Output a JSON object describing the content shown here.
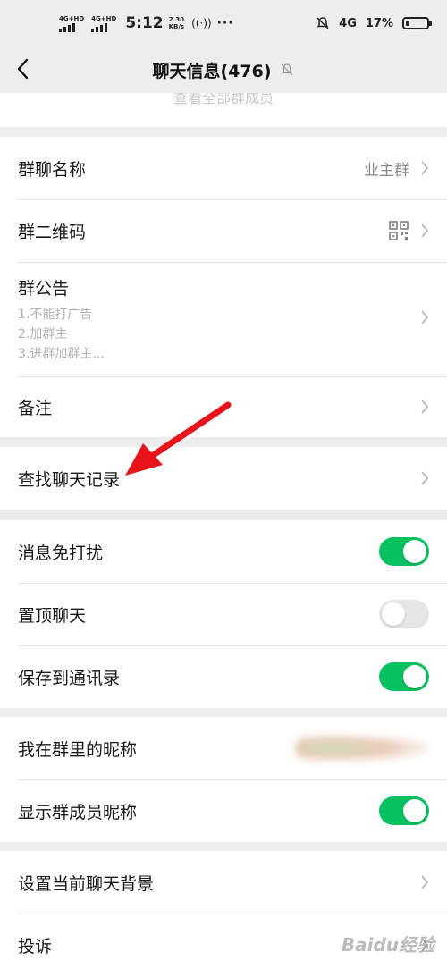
{
  "statusbar": {
    "sim1": "4G+HD",
    "sim2": "4G+HD",
    "time": "5:12",
    "speed_value": "2.30",
    "speed_unit": "KB/s",
    "more": "···",
    "network": "4G",
    "battery": "17%",
    "battery_level": 0.17
  },
  "navbar": {
    "title": "聊天信息(476)"
  },
  "partial_text": "查看全部群成员",
  "section1": {
    "group_name_label": "群聊名称",
    "group_name_value": "业主群",
    "qr_label": "群二维码",
    "notice_label": "群公告",
    "notice_lines": [
      "1.不能打广告",
      "2.加群主",
      "3.进群加群主..."
    ],
    "remark_label": "备注"
  },
  "section2": {
    "search_label": "查找聊天记录"
  },
  "section3": {
    "mute_label": "消息免打扰",
    "mute_on": true,
    "pin_label": "置顶聊天",
    "pin_on": false,
    "save_label": "保存到通讯录",
    "save_on": true
  },
  "section4": {
    "nickname_label": "我在群里的昵称",
    "show_nick_label": "显示群成员昵称",
    "show_nick_on": true
  },
  "section5": {
    "background_label": "设置当前聊天背景",
    "complain_label": "投诉"
  },
  "colors": {
    "accent": "#07c160",
    "arrow": "#e8141b",
    "background": "#ededed"
  },
  "watermark": "Baidu经验"
}
